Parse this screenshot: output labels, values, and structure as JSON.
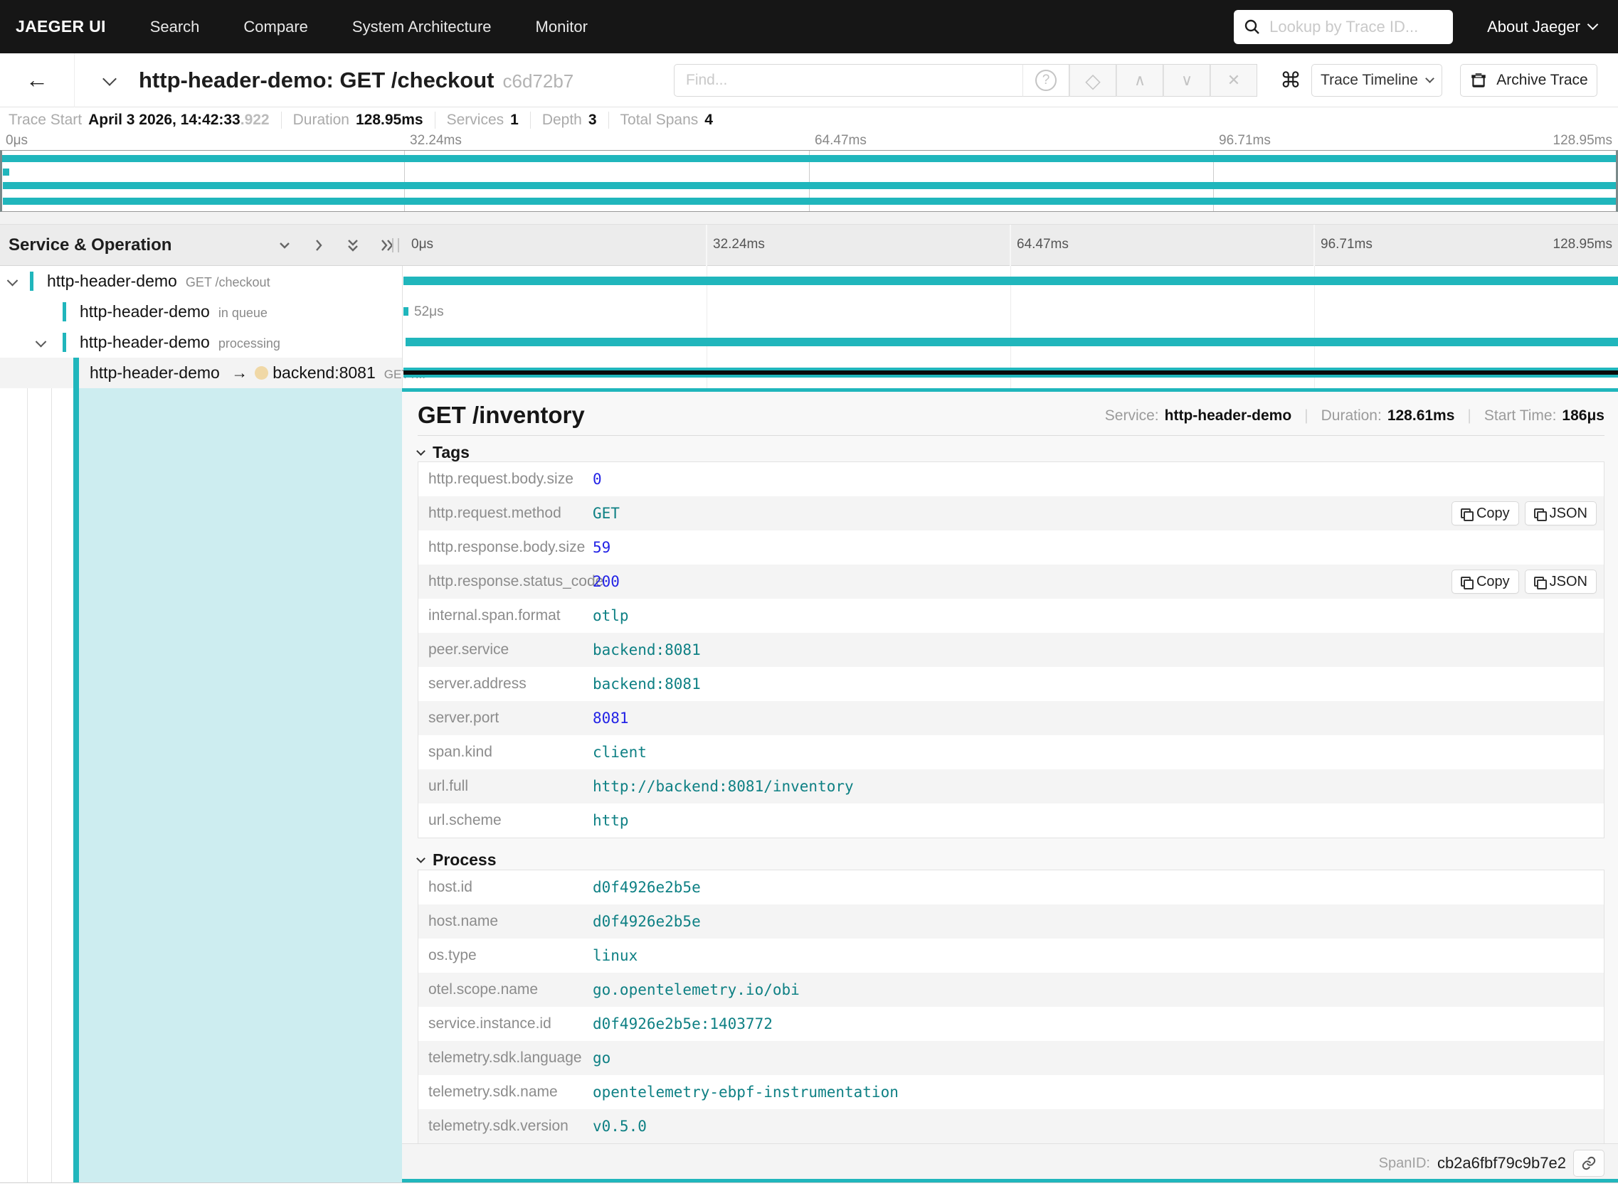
{
  "colors": {
    "teal": "#20b6bc",
    "teal_light": "#cdedf0",
    "peer_dot": "#f0d8a6",
    "string_value": "#0e8084",
    "number_value": "#2323e6"
  },
  "nav": {
    "brand": "JAEGER UI",
    "menu": [
      "Search",
      "Compare",
      "System Architecture",
      "Monitor"
    ],
    "lookup_placeholder": "Lookup by Trace ID...",
    "about_label": "About Jaeger"
  },
  "trace_header": {
    "title": "http-header-demo: GET /checkout",
    "trace_id": "c6d72b7",
    "find_placeholder": "Find...",
    "view_label": "Trace Timeline",
    "archive_label": "Archive Trace"
  },
  "summary": {
    "trace_start_label": "Trace Start",
    "trace_start_value": "April 3 2026, 14:42:33",
    "trace_start_frac": ".922",
    "duration_label": "Duration",
    "duration_value": "128.95ms",
    "services_label": "Services",
    "services_value": "1",
    "depth_label": "Depth",
    "depth_value": "3",
    "spans_label": "Total Spans",
    "spans_value": "4"
  },
  "ruler": {
    "t0": "0μs",
    "t1": "32.24ms",
    "t2": "64.47ms",
    "t3": "96.71ms",
    "t4": "128.95ms"
  },
  "timeline": {
    "header": "Service & Operation",
    "rows": [
      {
        "service": "http-header-demo",
        "op": "GET /checkout"
      },
      {
        "service": "http-header-demo",
        "op": "in queue",
        "dur": "52μs"
      },
      {
        "service": "http-header-demo",
        "op": "processing"
      },
      {
        "service": "http-header-demo",
        "arrow": "→",
        "peer": "backend:8081",
        "op": "GET /..."
      }
    ]
  },
  "detail": {
    "title": "GET /inventory",
    "service_label": "Service:",
    "service_value": "http-header-demo",
    "duration_label": "Duration:",
    "duration_value": "128.61ms",
    "start_label": "Start Time:",
    "start_value": "186μs",
    "tags_title": "Tags",
    "copy_label": "Copy",
    "json_label": "JSON",
    "tags": [
      {
        "key": "http.request.body.size",
        "value": "0"
      },
      {
        "key": "http.request.method",
        "value": "GET"
      },
      {
        "key": "http.response.body.size",
        "value": "59"
      },
      {
        "key": "http.response.status_code",
        "value": "200"
      },
      {
        "key": "internal.span.format",
        "value": "otlp"
      },
      {
        "key": "peer.service",
        "value": "backend:8081"
      },
      {
        "key": "server.address",
        "value": "backend:8081"
      },
      {
        "key": "server.port",
        "value": "8081"
      },
      {
        "key": "span.kind",
        "value": "client"
      },
      {
        "key": "url.full",
        "value": "http://backend:8081/inventory"
      },
      {
        "key": "url.scheme",
        "value": "http"
      }
    ],
    "process_title": "Process",
    "process": [
      {
        "key": "host.id",
        "value": "d0f4926e2b5e"
      },
      {
        "key": "host.name",
        "value": "d0f4926e2b5e"
      },
      {
        "key": "os.type",
        "value": "linux"
      },
      {
        "key": "otel.scope.name",
        "value": "go.opentelemetry.io/obi"
      },
      {
        "key": "service.instance.id",
        "value": "d0f4926e2b5e:1403772"
      },
      {
        "key": "telemetry.sdk.language",
        "value": "go"
      },
      {
        "key": "telemetry.sdk.name",
        "value": "opentelemetry-ebpf-instrumentation"
      },
      {
        "key": "telemetry.sdk.version",
        "value": "v0.5.0"
      }
    ],
    "spanid_label": "SpanID:",
    "spanid_value": "cb2a6fbf79c9b7e2"
  }
}
